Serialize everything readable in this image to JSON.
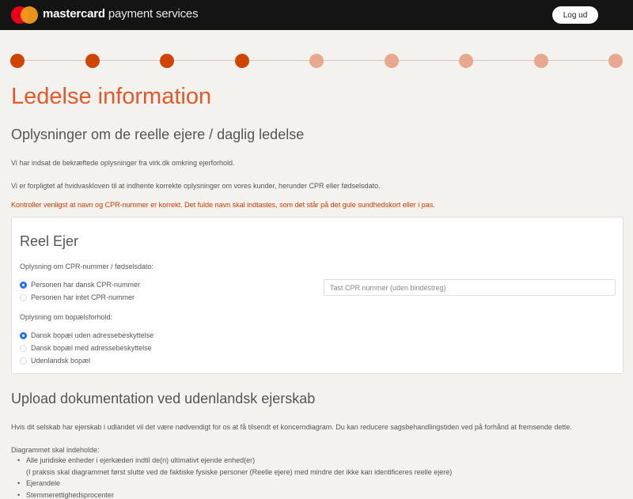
{
  "header": {
    "brand_bold": "mastercard",
    "brand_light": " payment services",
    "logout_label": "Log ud",
    "logo_icon": "mastercard-logo-icon"
  },
  "stepper": {
    "total_steps": 9,
    "completed_steps": 4,
    "colors": {
      "done": "#cf4500",
      "todo": "#e8a890"
    }
  },
  "page": {
    "title": "Ledelse information",
    "subtitle": "Oplysninger om de reelle ejere / daglig ledelse",
    "intro1": "Vi har indsat de bekræftede oplysninger fra virk.dk omkring ejerforhold.",
    "intro2": "Vi er forpligtet af hvidvaskloven til at indhente korrekte oplysninger om vores kunder, herunder CPR eller fødselsdato.",
    "warning": "Kontroller venligst at navn og CPR-nummer er korrekt. Det fulde navn skal indtastes, som det står på det gule sundhedskort eller i pas."
  },
  "owner_card": {
    "title": "Reel Ejer",
    "cpr_label": "Oplysning om CPR-nummer / fødselsdato:",
    "cpr_options": [
      "Personen har dansk CPR-nummer",
      "Personen har intet CPR-nummer"
    ],
    "cpr_selected": 0,
    "cpr_placeholder": "Tast CPR nummer (uden bindestreg)",
    "residence_label": "Oplysning om bopælsforhold:",
    "residence_options": [
      "Dansk bopæl uden adressebeskyttelse",
      "Dansk bopæl med adressebeskyttelse",
      "Udenlandsk bopæl"
    ],
    "residence_selected": 0
  },
  "upload": {
    "title": "Upload dokumentation ved udenlandsk ejerskab",
    "text": "Hvis dit selskab har ejerskab i udlandet vil det være nødvendigt for os at få tilsendt et koncerndiagram. Du kan reducere sagsbehandlingstiden ved på forhånd at fremsende dette.",
    "diagram_label": "Diagrammet skal indeholde:",
    "items": [
      "Alle juridiske enheder i ejerkæden indtil de(n) ultimativt ejende enhed(er)",
      "Ejerandele",
      "Stemmerettighedsprocenter"
    ],
    "item_note": "(I praksis skal diagrammet først slutte ved de faktiske fysiske personer (Reelle ejere) med mindre der ikke kan identificeres reelle ejere)",
    "bullet_char": "•"
  }
}
